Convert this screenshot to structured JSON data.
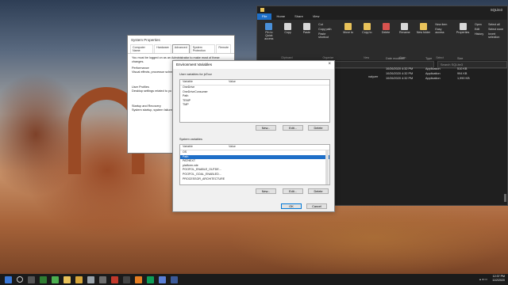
{
  "system_properties": {
    "title": "System Properties",
    "tabs": [
      "Computer Name",
      "Hardware",
      "Advanced",
      "System Protection",
      "Remote"
    ],
    "active_tab": "Advanced",
    "notice": "You must be logged on as an Administrator to make most of these changes.",
    "performance_label": "Performance",
    "performance_text": "Visual effects, processor sched",
    "user_profiles_label": "User Profiles",
    "user_profiles_text": "Desktop settings related to yo",
    "startup_label": "Startup and Recovery",
    "startup_text": "System startup, system failure,"
  },
  "explorer": {
    "title": "SQLite3",
    "menu": [
      "File",
      "Home",
      "Share",
      "View"
    ],
    "ribbon": {
      "pin": "Pin to Quick access",
      "copy": "Copy",
      "paste": "Paste",
      "cut": "Cut",
      "copy_path": "Copy path",
      "paste_shortcut": "Paste shortcut",
      "move_to": "Move to",
      "copy_to": "Copy to",
      "delete": "Delete",
      "rename": "Rename",
      "new_folder": "New folder",
      "new_item": "New item",
      "easy_access": "Easy access",
      "properties": "Properties",
      "open": "Open",
      "edit": "Edit",
      "history": "History",
      "select_all": "Select all",
      "select_none": "Select none",
      "invert_selection": "Invert selection",
      "groups": [
        "Clipboard",
        "Organize",
        "New",
        "Open",
        "Select"
      ]
    },
    "address": [
      "This PC",
      "Windows (C:)",
      "SQLite3"
    ],
    "search_placeholder": "Search SQLite3",
    "columns": [
      "Date modified",
      "Type",
      "Size"
    ],
    "files": [
      {
        "date": "10/26/2020 4:32 PM",
        "type": "Application",
        "size": "510 KB"
      },
      {
        "date": "10/26/2020 4:32 PM",
        "type": "Application",
        "size": "994 KB"
      },
      {
        "date": "10/26/2020 4:32 PM",
        "type": "Application",
        "size": "1,990 KB"
      }
    ],
    "partial_name": "nalyzer"
  },
  "env_dialog": {
    "title": "Environment Variables",
    "user_section": "User variables for jsTour",
    "col_variable": "Variable",
    "col_value": "Value",
    "user_vars": [
      "OneDrive",
      "OneDriveConsumer",
      "Path",
      "TEMP",
      "TMP"
    ],
    "system_section": "System variables",
    "system_vars": [
      "OS",
      "Path",
      "PATHEXT",
      "platform.vde",
      "POOFOL_ENABLE_OUTDE...",
      "POOFOL_GOAL_ENABLED...",
      "PROCESSOR_ARCHITECTURE"
    ],
    "selected_system_var": "Path",
    "btn_new": "New...",
    "btn_edit": "Edit...",
    "btn_delete": "Delete",
    "btn_ok": "OK",
    "btn_cancel": "Cancel"
  },
  "taskbar": {
    "time": "12:37 PM",
    "date": "11/2/2020"
  }
}
